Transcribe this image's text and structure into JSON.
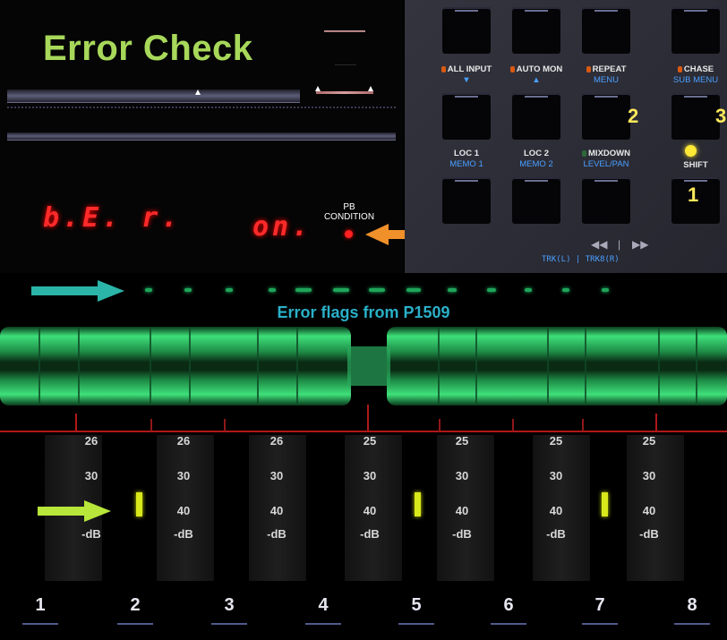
{
  "title": "Error Check",
  "display": {
    "left_text": "b.E. r.",
    "right_text": "on.",
    "pb_condition_label": "PB\nCONDITION"
  },
  "buttons": [
    {
      "id": "all-input",
      "label": "ALL INPUT",
      "sub": "▼",
      "led": "orange"
    },
    {
      "id": "auto-mon",
      "label": "AUTO MON",
      "sub": "▲",
      "led": "orange"
    },
    {
      "id": "repeat",
      "label": "REPEAT",
      "sub": "MENU",
      "led": "orange",
      "num": "2"
    },
    {
      "id": "chase",
      "label": "CHASE",
      "sub": "SUB MENU",
      "led": "orange",
      "num": "3"
    },
    {
      "id": "loc1",
      "label": "LOC 1",
      "sub": "MEMO 1"
    },
    {
      "id": "loc2",
      "label": "LOC 2",
      "sub": "MEMO 2"
    },
    {
      "id": "mixdown",
      "label": "MIXDOWN",
      "sub": "LEVEL/PAN",
      "led": "green"
    },
    {
      "id": "shift",
      "label": "SHIFT",
      "num": "1"
    }
  ],
  "track_select_label": "TRK(L) | TRK8(R)",
  "flags_caption": "Error flags from P1509",
  "meter_scale": [
    "25",
    "30",
    "40",
    "-dB"
  ],
  "meter_scale_ch1": [
    "26",
    "30",
    "40",
    "-dB"
  ],
  "channels": [
    "1",
    "2",
    "3",
    "4",
    "5",
    "6",
    "7",
    "8"
  ],
  "error_peaks": {
    "channels": [
      "2",
      "5",
      "7"
    ]
  },
  "colors": {
    "title": "#a7d85a",
    "led_red": "#ff2a2a",
    "teal_arrow": "#2bb5a8",
    "orange_arrow": "#f0902a",
    "yellow_arrow": "#b8e63a",
    "meter_green": "#3ee07a",
    "peak_yellow": "#d8e81a",
    "caption": "#2ab0c8"
  }
}
